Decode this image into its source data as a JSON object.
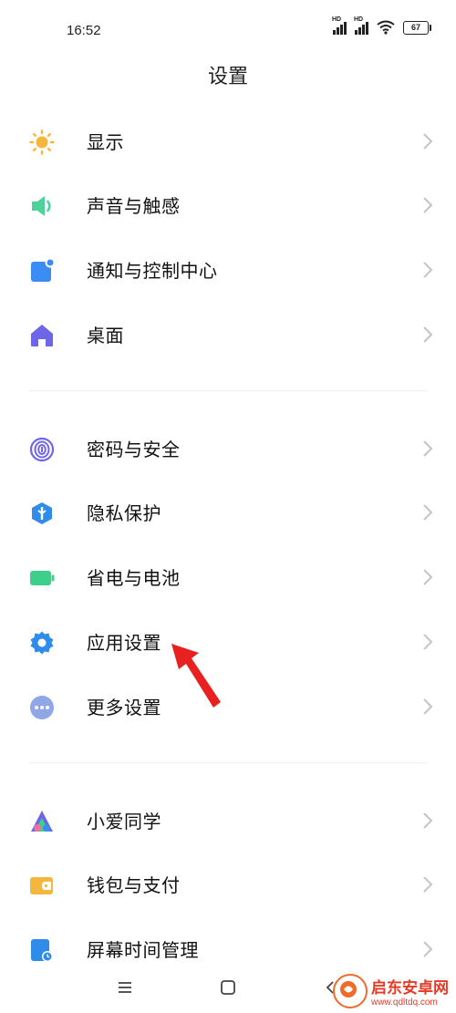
{
  "status": {
    "time": "16:52",
    "battery": "67",
    "signal_tag": "HD"
  },
  "header": {
    "title": "设置"
  },
  "groups": [
    {
      "items": [
        {
          "label": "显示",
          "icon": "sun-icon",
          "color": "#F5B73B"
        },
        {
          "label": "声音与触感",
          "icon": "speaker-icon",
          "color": "#4CD29A"
        },
        {
          "label": "通知与控制中心",
          "icon": "notification-icon",
          "color": "#3B8DF5"
        },
        {
          "label": "桌面",
          "icon": "home-icon",
          "color": "#6E66E8"
        }
      ]
    },
    {
      "items": [
        {
          "label": "密码与安全",
          "icon": "fingerprint-icon",
          "color": "#6E66E8"
        },
        {
          "label": "隐私保护",
          "icon": "shield-icon",
          "color": "#2F8CE8"
        },
        {
          "label": "省电与电池",
          "icon": "battery-icon",
          "color": "#3DD08A"
        },
        {
          "label": "应用设置",
          "icon": "gear-icon",
          "color": "#2F8CE8"
        },
        {
          "label": "更多设置",
          "icon": "more-icon",
          "color": "#8FA6E8"
        }
      ]
    },
    {
      "items": [
        {
          "label": "小爱同学",
          "icon": "xiaoai-icon",
          "color": "#6E66E8"
        },
        {
          "label": "钱包与支付",
          "icon": "wallet-icon",
          "color": "#F5B73B"
        },
        {
          "label": "屏幕时间管理",
          "icon": "screen-time-icon",
          "color": "#2F8CE8"
        }
      ]
    }
  ],
  "watermark": {
    "name": "启东安卓网",
    "url": "www.qdltdq.com"
  }
}
